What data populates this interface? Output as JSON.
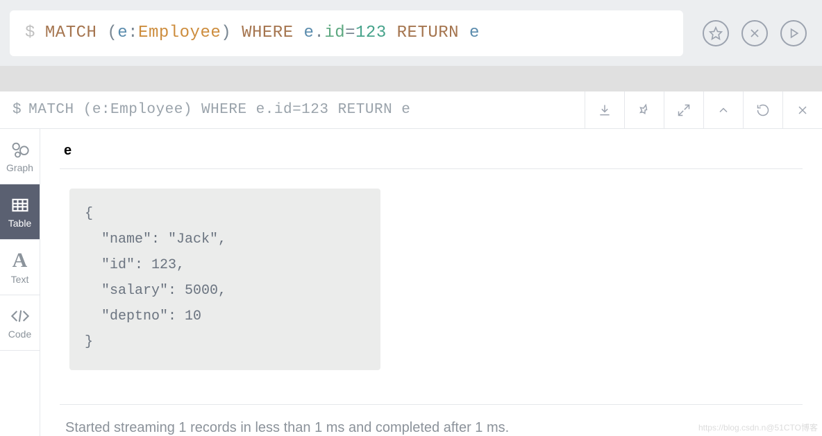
{
  "editor": {
    "prompt": "$",
    "tokens": {
      "match": "MATCH",
      "lp1": "(",
      "var1": "e",
      "colon": ":",
      "label": "Employee",
      "rp1": ")",
      "where": "WHERE",
      "var2": "e",
      "dot": ".",
      "prop": "id",
      "eq": "=",
      "num": "123",
      "return": "RETURN",
      "var3": "e"
    },
    "plain_query": "MATCH (e:Employee) WHERE e.id=123 RETURN e"
  },
  "rail": {
    "graph": "Graph",
    "table": "Table",
    "text": "Text",
    "code": "Code"
  },
  "result": {
    "column": "e",
    "json_text": "{\n  \"name\": \"Jack\",\n  \"id\": 123,\n  \"salary\": 5000,\n  \"deptno\": 10\n}"
  },
  "chart_data": {
    "type": "table",
    "columns": [
      "e"
    ],
    "rows": [
      {
        "name": "Jack",
        "id": 123,
        "salary": 5000,
        "deptno": 10
      }
    ]
  },
  "status": "Started streaming 1 records in less than 1 ms and completed after 1 ms.",
  "watermark": "https://blog.csdn.n@51CTO博客"
}
